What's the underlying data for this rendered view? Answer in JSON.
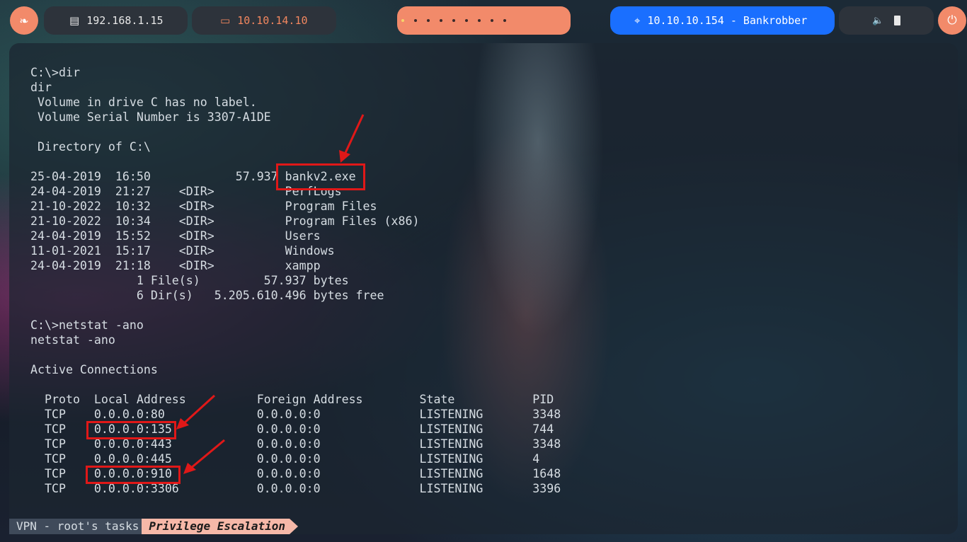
{
  "topbar": {
    "host_ip": "192.168.1.15",
    "vpn_ip": "10.10.14.10",
    "target_label": "10.10.10.154 - Bankrobber",
    "host_icon": "monitor-icon",
    "vpn_icon": "laptop-icon",
    "target_icon": "crosshair-icon",
    "volume_icon": "volume-icon",
    "battery_icon": "battery-icon",
    "menu_icon": "kali-dragon-icon",
    "power_icon": "power-icon",
    "colors": {
      "accent_orange": "#f28a6a",
      "target_blue": "#1a6fff",
      "dark_pill": "#2d333b"
    }
  },
  "terminal": {
    "lines": [
      "C:\\>dir",
      "dir",
      " Volume in drive C has no label.",
      " Volume Serial Number is 3307-A1DE",
      "",
      " Directory of C:\\",
      "",
      "25-04-2019  16:50            57.937 bankv2.exe",
      "24-04-2019  21:27    <DIR>          PerfLogs",
      "21-10-2022  10:32    <DIR>          Program Files",
      "21-10-2022  10:34    <DIR>          Program Files (x86)",
      "24-04-2019  15:52    <DIR>          Users",
      "11-01-2021  15:17    <DIR>          Windows",
      "24-04-2019  21:18    <DIR>          xampp",
      "               1 File(s)         57.937 bytes",
      "               6 Dir(s)   5.205.610.496 bytes free",
      "",
      "C:\\>netstat -ano",
      "netstat -ano",
      "",
      "Active Connections",
      "",
      "  Proto  Local Address          Foreign Address        State           PID",
      "  TCP    0.0.0.0:80             0.0.0.0:0              LISTENING       3348",
      "  TCP    0.0.0.0:135            0.0.0.0:0              LISTENING       744",
      "  TCP    0.0.0.0:443            0.0.0.0:0              LISTENING       3348",
      "  TCP    0.0.0.0:445            0.0.0.0:0              LISTENING       4",
      "  TCP    0.0.0.0:910            0.0.0.0:0              LISTENING       1648",
      "  TCP    0.0.0.0:3306           0.0.0.0:0              LISTENING       3396"
    ]
  },
  "statusline": {
    "session": "VPN - root's tasks",
    "window": "Privilege Escalation"
  }
}
